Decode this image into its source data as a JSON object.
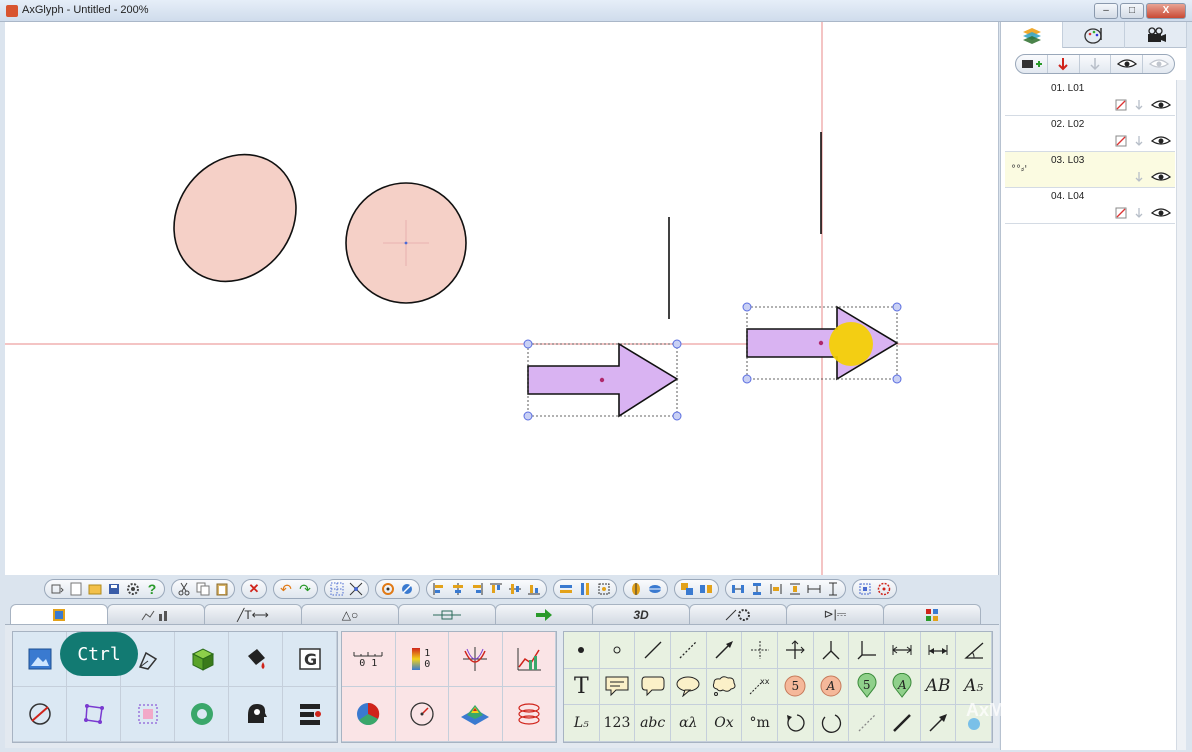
{
  "window": {
    "title": "AxGlyph - Untitled - 200%",
    "minimize": "–",
    "maximize": "□",
    "close": "X"
  },
  "overlays": {
    "ctrl_key": "Ctrl",
    "watermark_left": "AxMath",
    "watermark_right": "bilibili"
  },
  "right_panel": {
    "layers": [
      {
        "name": "01. L01",
        "selected": false,
        "badge": ""
      },
      {
        "name": "02. L02",
        "selected": false,
        "badge": ""
      },
      {
        "name": "03. L03",
        "selected": true,
        "badge": "°°⸗'"
      },
      {
        "name": "04. L04",
        "selected": false,
        "badge": ""
      }
    ]
  },
  "palette": {
    "tabs": [
      "",
      "",
      "╱T⟷",
      "△○",
      "",
      "",
      "3D",
      "",
      "⊳|⎓",
      ""
    ],
    "math": {
      "row2": [
        "T",
        "",
        "",
        "",
        "",
        "",
        "5",
        "A",
        "5",
        "A",
        "AB",
        "A₅"
      ],
      "row3": [
        "L₅",
        "123",
        "abc",
        "αλ",
        "Ox",
        "°m",
        "",
        "",
        "",
        "",
        "",
        ""
      ]
    },
    "gauge": [
      "0 1",
      "1 0"
    ]
  },
  "colors": {
    "ellipse_fill": "#f5d0c7",
    "arrow_fill": "#d9b3f2",
    "guide": "#e88a8a",
    "highlight": "#f5d000",
    "handle": "#5b6ee0",
    "title_accent": "#d8542f"
  }
}
